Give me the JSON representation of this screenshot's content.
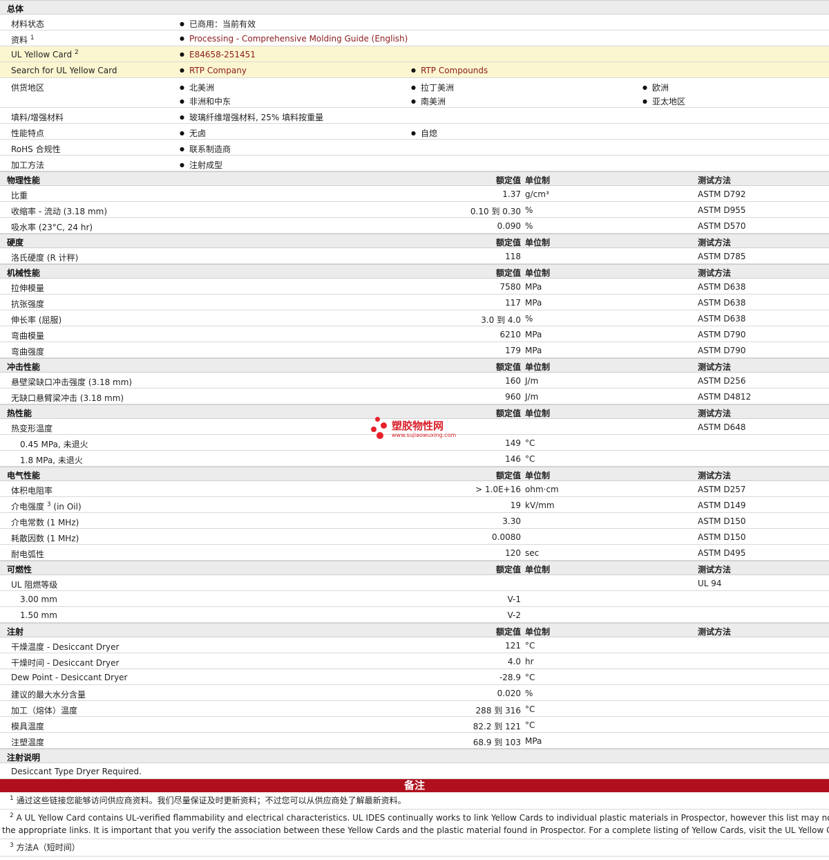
{
  "general": {
    "title": "总体",
    "material_status": {
      "label": "材料状态",
      "value": "已商用：当前有效"
    },
    "literature": {
      "label": "资料",
      "sup": "1",
      "value": "Processing - Comprehensive Molding Guide (English)"
    },
    "ul_yellow_card": {
      "label": "UL Yellow Card",
      "sup": "2",
      "value": "E84658-251451"
    },
    "search_ul": {
      "label": "Search for UL Yellow Card",
      "values": [
        "RTP Company",
        "RTP Compounds"
      ]
    },
    "availability": {
      "label": "供货地区",
      "values": [
        "北美洲",
        "拉丁美洲",
        "欧洲",
        "非洲和中东",
        "南美洲",
        "亚太地区"
      ]
    },
    "filler": {
      "label": "填料/增强材料",
      "value": "玻璃纤维增强材料, 25% 填料按重量"
    },
    "features": {
      "label": "性能特点",
      "values": [
        "无卤",
        "自熄"
      ]
    },
    "rohs": {
      "label": "RoHS 合规性",
      "value": "联系制造商"
    },
    "processing": {
      "label": "加工方法",
      "value": "注射成型"
    }
  },
  "headers": {
    "nominal": "额定值",
    "unit": "单位制",
    "method": "测试方法"
  },
  "physical": {
    "title": "物理性能",
    "rows": [
      {
        "name": "比重",
        "value": "1.37",
        "unit": "g/cm³",
        "method": "ASTM D792"
      },
      {
        "name": "收缩率  - 流动  (3.18 mm)",
        "value": "0.10 到  0.30",
        "unit": "%",
        "method": "ASTM D955"
      },
      {
        "name": "吸水率  (23°C, 24 hr)",
        "value": "0.090",
        "unit": "%",
        "method": "ASTM D570"
      }
    ]
  },
  "hardness": {
    "title": "硬度",
    "rows": [
      {
        "name": "洛氏硬度  (R 计秤)",
        "value": "118",
        "unit": "",
        "method": "ASTM D785"
      }
    ]
  },
  "mechanical": {
    "title": "机械性能",
    "rows": [
      {
        "name": "拉伸模量",
        "value": "7580",
        "unit": "MPa",
        "method": "ASTM D638"
      },
      {
        "name": "抗张强度",
        "value": "117",
        "unit": "MPa",
        "method": "ASTM D638"
      },
      {
        "name": "伸长率  (屈服)",
        "value": "3.0 到  4.0",
        "unit": "%",
        "method": "ASTM D638"
      },
      {
        "name": "弯曲模量",
        "value": "6210",
        "unit": "MPa",
        "method": "ASTM D790"
      },
      {
        "name": "弯曲强度",
        "value": "179",
        "unit": "MPa",
        "method": "ASTM D790"
      }
    ]
  },
  "impact": {
    "title": "冲击性能",
    "rows": [
      {
        "name": "悬壁梁缺口冲击强度  (3.18 mm)",
        "value": "160",
        "unit": "J/m",
        "method": "ASTM D256"
      },
      {
        "name": "无缺口悬臂梁冲击  (3.18 mm)",
        "value": "960",
        "unit": "J/m",
        "method": "ASTM D4812"
      }
    ]
  },
  "thermal": {
    "title": "热性能",
    "rows": [
      {
        "name": "热变形温度",
        "value": "",
        "unit": "",
        "method": "ASTM D648"
      },
      {
        "name": "0.45 MPa, 未退火",
        "value": "149",
        "unit": "°C",
        "method": ""
      },
      {
        "name": "1.8 MPa, 未退火",
        "value": "146",
        "unit": "°C",
        "method": ""
      }
    ]
  },
  "electrical": {
    "title": "电气性能",
    "rows": [
      {
        "name": "体积电阻率",
        "value": "> 1.0E+16",
        "unit": "ohm·cm",
        "method": "ASTM D257"
      },
      {
        "name": "介电强度",
        "sup": "3",
        "suffix": " (in Oil)",
        "value": "19",
        "unit": "kV/mm",
        "method": "ASTM D149"
      },
      {
        "name": "介电常数  (1 MHz)",
        "value": "3.30",
        "unit": "",
        "method": "ASTM D150"
      },
      {
        "name": "耗散因数  (1 MHz)",
        "value": "0.0080",
        "unit": "",
        "method": "ASTM D150"
      },
      {
        "name": "耐电弧性",
        "value": "120",
        "unit": "sec",
        "method": "ASTM D495"
      }
    ]
  },
  "flammability": {
    "title": "可燃性",
    "rows": [
      {
        "name": "UL 阻燃等级",
        "value": "",
        "unit": "",
        "method": "UL 94"
      },
      {
        "name": "3.00 mm",
        "value": "V-1",
        "unit": "",
        "method": ""
      },
      {
        "name": "1.50 mm",
        "value": "V-2",
        "unit": "",
        "method": ""
      }
    ]
  },
  "injection": {
    "title": "注射",
    "rows": [
      {
        "name": "干燥温度  - Desiccant Dryer",
        "value": "121",
        "unit": "°C",
        "method": ""
      },
      {
        "name": "干燥时间  - Desiccant Dryer",
        "value": "4.0",
        "unit": "hr",
        "method": ""
      },
      {
        "name": "Dew Point - Desiccant Dryer",
        "value": "-28.9",
        "unit": "°C",
        "method": ""
      },
      {
        "name": "建议的最大水分含量",
        "value": "0.020",
        "unit": "%",
        "method": ""
      },
      {
        "name": "加工（熔体）温度",
        "value": "288 到  316",
        "unit": "°C",
        "method": ""
      },
      {
        "name": "模具温度",
        "value": "82.2 到  121",
        "unit": "°C",
        "method": ""
      },
      {
        "name": "注塑温度",
        "value": "68.9 到  103",
        "unit": "MPa",
        "method": ""
      }
    ]
  },
  "injection_notes": {
    "title": "注射说明",
    "text": "Desiccant Type Dryer Required."
  },
  "notes": {
    "title": "备注",
    "n1": {
      "sup": "1",
      "text": "通过这些链接您能够访问供应商资料。我们尽量保证及时更新资料；不过您可以从供应商处了解最新资料。"
    },
    "n2": {
      "sup": "2",
      "line1": "A UL Yellow Card contains UL-verified flammability and electrical characteristics. UL IDES continually works to link Yellow Cards to individual plastic materials in Prospector, however this list may not inclu",
      "line2": "the appropriate links. It is important that you verify the association between these Yellow Cards and the plastic material found in Prospector. For a complete listing of Yellow Cards, visit the UL Yellow Card Sea"
    },
    "n3": {
      "sup": "3",
      "text": "方法A（短时间）"
    }
  },
  "watermark": {
    "title": "塑胶物性网",
    "url": "www.sujiaowuxing.com"
  }
}
